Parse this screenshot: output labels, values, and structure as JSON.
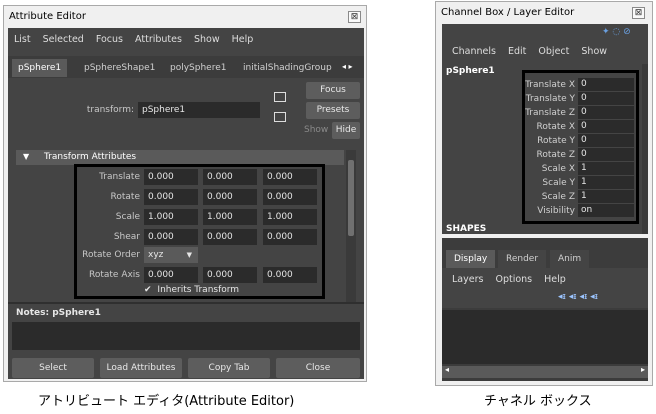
{
  "attribute_editor": {
    "title": "Attribute Editor",
    "menu": [
      "List",
      "Selected",
      "Focus",
      "Attributes",
      "Show",
      "Help"
    ],
    "tabs": [
      "pSphere1",
      "pSphereShape1",
      "polySphere1",
      "initialShadingGroup"
    ],
    "transform_label": "transform:",
    "transform_value": "pSphere1",
    "focus_button": "Focus",
    "presets_button": "Presets",
    "show_label": "Show",
    "hide_button": "Hide",
    "section_title": "Transform Attributes",
    "rows": [
      {
        "label": "Translate",
        "values": [
          "0.000",
          "0.000",
          "0.000"
        ]
      },
      {
        "label": "Rotate",
        "values": [
          "0.000",
          "0.000",
          "0.000"
        ]
      },
      {
        "label": "Scale",
        "values": [
          "1.000",
          "1.000",
          "1.000"
        ]
      },
      {
        "label": "Shear",
        "values": [
          "0.000",
          "0.000",
          "0.000"
        ]
      }
    ],
    "rotate_order_label": "Rotate Order",
    "rotate_order_value": "xyz",
    "rotate_axis_label": "Rotate Axis",
    "rotate_axis_values": [
      "0.000",
      "0.000",
      "0.000"
    ],
    "inherits_transform_label": "Inherits Transform",
    "notes_label": "Notes: pSphere1",
    "bottom_buttons": [
      "Select",
      "Load Attributes",
      "Copy Tab",
      "Close"
    ]
  },
  "channel_box": {
    "title": "Channel Box / Layer Editor",
    "menu": [
      "Channels",
      "Edit",
      "Object",
      "Show"
    ],
    "object_name": "pSphere1",
    "channels": [
      {
        "label": "Translate X",
        "value": "0"
      },
      {
        "label": "Translate Y",
        "value": "0"
      },
      {
        "label": "Translate Z",
        "value": "0"
      },
      {
        "label": "Rotate X",
        "value": "0"
      },
      {
        "label": "Rotate Y",
        "value": "0"
      },
      {
        "label": "Rotate Z",
        "value": "0"
      },
      {
        "label": "Scale X",
        "value": "1"
      },
      {
        "label": "Scale Y",
        "value": "1"
      },
      {
        "label": "Scale Z",
        "value": "1"
      },
      {
        "label": "Visibility",
        "value": "on"
      }
    ],
    "shapes_label": "SHAPES",
    "tabs": [
      "Display",
      "Render",
      "Anim"
    ],
    "layer_menu": [
      "Layers",
      "Options",
      "Help"
    ]
  },
  "captions": {
    "left": "アトリビュート エディタ(Attribute Editor)",
    "right": "チャネル ボックス"
  },
  "icons": {
    "close": "close-icon",
    "checkmark": "checkmark-icon",
    "dropdown": "chevron-down-icon",
    "tab_scroll": "arrow-left-right-icon"
  }
}
